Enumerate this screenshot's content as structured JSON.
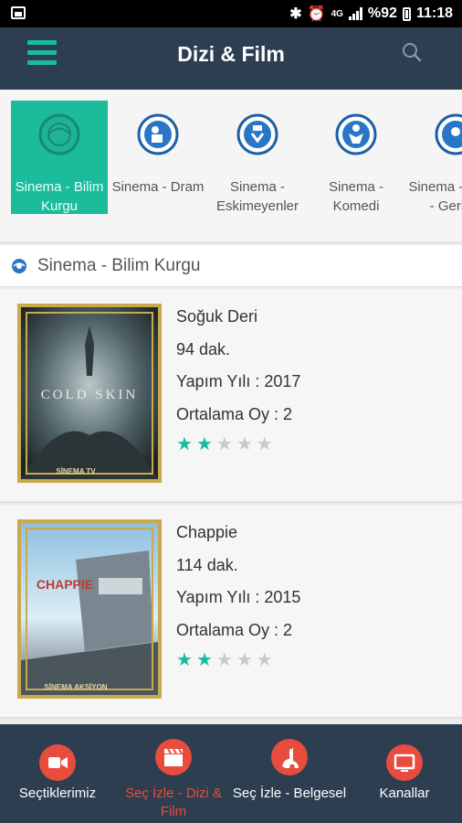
{
  "status_bar": {
    "network": "4G",
    "battery": "%92",
    "time": "11:18"
  },
  "app_bar": {
    "title": "Dizi & Film"
  },
  "categories": [
    {
      "label": "Sinema - Bilim Kurgu",
      "icon": "globe-icon",
      "active": true
    },
    {
      "label": "Sinema - Dram",
      "icon": "drama-icon",
      "active": false
    },
    {
      "label": "Sinema - Eskimeyenler",
      "icon": "award-icon",
      "active": false
    },
    {
      "label": "Sinema - Komedi",
      "icon": "comedy-icon",
      "active": false
    },
    {
      "label": "Sinema - Korku - Gerilim",
      "icon": "horror-icon",
      "active": false
    }
  ],
  "section": {
    "title": "Sinema - Bilim Kurgu"
  },
  "movies": [
    {
      "title": "Soğuk Deri",
      "duration": "94 dak.",
      "year": "Yapım Yılı : 2017",
      "rating_text": "Ortalama Oy : 2",
      "rating": 2,
      "max_rating": 5,
      "poster_text": "COLD SKIN",
      "poster_brand": "SİNEMA TV"
    },
    {
      "title": "Chappie",
      "duration": "114 dak.",
      "year": "Yapım Yılı : 2015",
      "rating_text": "Ortalama Oy : 2",
      "rating": 2,
      "max_rating": 5,
      "poster_text": "CHAPPIE",
      "poster_brand": "SİNEMA AKSİYON"
    }
  ],
  "bottom_nav": [
    {
      "label": "Seçtiklerimiz",
      "icon": "video-icon",
      "active": false
    },
    {
      "label": "Seç İzle - Dizi & Film",
      "icon": "clapperboard-icon",
      "active": true
    },
    {
      "label": "Seç İzle - Belgesel",
      "icon": "dinosaur-icon",
      "active": false
    },
    {
      "label": "Kanallar",
      "icon": "tv-icon",
      "active": false
    }
  ],
  "colors": {
    "primary": "#2c3e50",
    "accent": "#1abc9c",
    "nav_accent": "#e74c3c",
    "poster_border": "#c9a94e"
  }
}
